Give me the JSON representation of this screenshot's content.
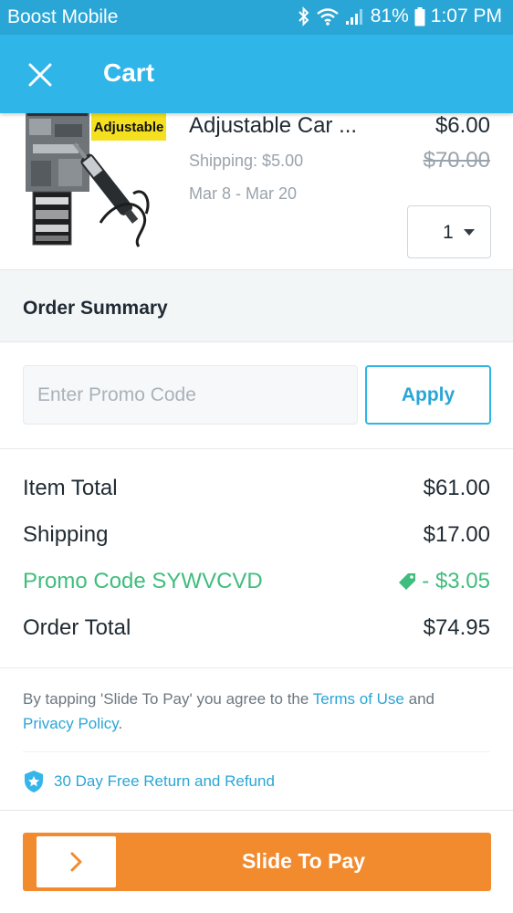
{
  "status_bar": {
    "carrier": "Boost Mobile",
    "battery": "81%",
    "time": "1:07 PM",
    "icons": [
      "bluetooth-icon",
      "wifi-icon",
      "signal-icon",
      "battery-icon"
    ]
  },
  "app_bar": {
    "title": "Cart",
    "close_icon": "close-icon"
  },
  "cart_item": {
    "image_label": "Adjustable",
    "title": "Adjustable Car ...",
    "price": "$6.00",
    "shipping": "Shipping: $5.00",
    "original_price": "$70.00",
    "dates": "Mar 8 - Mar 20",
    "quantity": "1"
  },
  "order_summary": {
    "title": "Order Summary",
    "promo_placeholder": "Enter Promo Code",
    "apply_label": "Apply",
    "rows": {
      "item_total": {
        "label": "Item Total",
        "value": "$61.00"
      },
      "shipping": {
        "label": "Shipping",
        "value": "$17.00"
      },
      "promo": {
        "label": "Promo Code SYWVCVD",
        "value": "- $3.05"
      },
      "order_total": {
        "label": "Order Total",
        "value": "$74.95"
      }
    }
  },
  "terms": {
    "prefix": "By tapping 'Slide To Pay' you agree to the ",
    "terms_link": "Terms of Use",
    "middle": " and",
    "privacy_link": "Privacy Policy",
    "suffix": "."
  },
  "guarantee": {
    "text": "30 Day Free Return and Refund"
  },
  "slide_to_pay": {
    "label": "Slide To Pay"
  },
  "colors": {
    "status_bar": "#2aa6d6",
    "app_bar": "#2fb5e8",
    "accent": "#2aa6d6",
    "promo_green": "#3fbd7c",
    "pay_orange": "#f28a2e"
  }
}
